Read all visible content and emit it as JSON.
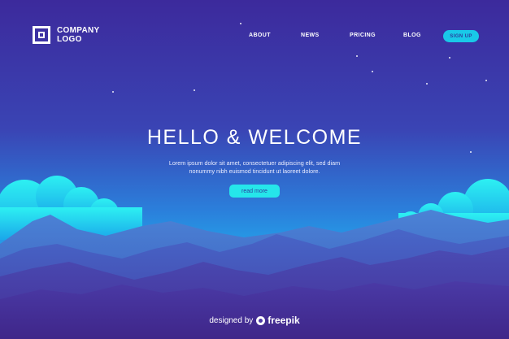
{
  "brand": {
    "logo_line1": "COMPANY",
    "logo_line2": "LOGO"
  },
  "nav": {
    "items": [
      {
        "label": "ABOUT"
      },
      {
        "label": "NEWS"
      },
      {
        "label": "PRICING"
      },
      {
        "label": "BLOG"
      }
    ],
    "signup_label": "SIGN UP"
  },
  "hero": {
    "title": "HELLO & WELCOME",
    "text_lines": [
      "Lorem ipsum dolor sit amet, consectetuer adipiscing elit, sed diam",
      "nonummy nibh euismod tincidunt ut laoreet dolore."
    ],
    "cta_label": "read more"
  },
  "credit": {
    "prefix": "designed by",
    "brand": "freepik"
  },
  "colors": {
    "background_top": "#3c2a9c",
    "background_bottom": "#1bc9f5",
    "accent_cyan": "#25e6ea",
    "mountain_front": "#4a2f98"
  },
  "icons": {
    "logo_mark": "square-logo-icon",
    "credit_icon": "freepik-icon"
  }
}
